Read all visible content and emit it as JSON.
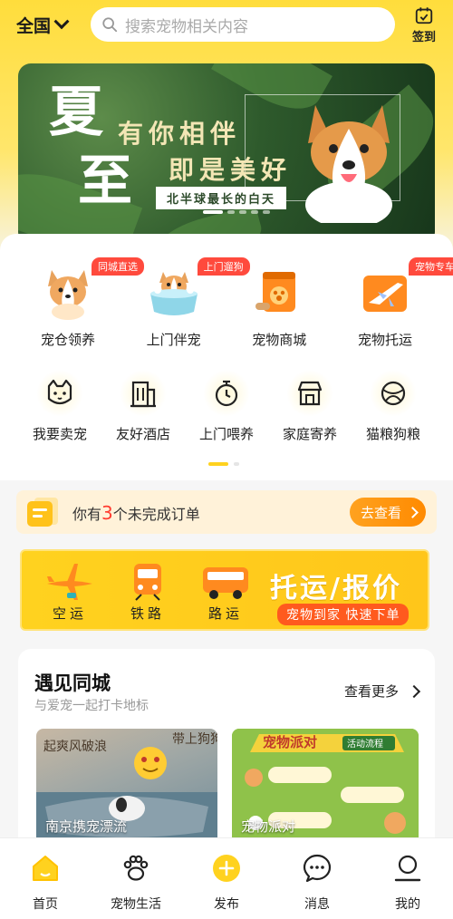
{
  "header": {
    "city": "全国",
    "search_placeholder": "搜索宠物相关内容",
    "checkin_label": "签到"
  },
  "banner": {
    "big_chars": [
      "夏",
      "至"
    ],
    "line1": "有你相伴",
    "line2": "即是美好",
    "tag": "北半球最长的白天",
    "slide_count": 5,
    "active_slide": 1
  },
  "services": {
    "primary": [
      {
        "label": "宠仓领养",
        "badge": "同城直选",
        "icon": "corgi-icon"
      },
      {
        "label": "上门伴宠",
        "badge": "上门遛狗",
        "icon": "dog-bath-icon"
      },
      {
        "label": "宠物商城",
        "badge": "",
        "icon": "pet-food-bag-icon"
      },
      {
        "label": "宠物托运",
        "badge": "宠物专车",
        "icon": "airplane-box-icon"
      }
    ],
    "secondary": [
      {
        "label": "我要卖宠",
        "icon": "cat-face-icon"
      },
      {
        "label": "友好酒店",
        "icon": "building-icon"
      },
      {
        "label": "上门喂养",
        "icon": "stopwatch-icon"
      },
      {
        "label": "家庭寄养",
        "icon": "house-icon"
      },
      {
        "label": "猫粮狗粮",
        "icon": "ball-icon"
      }
    ]
  },
  "orders": {
    "prefix": "你有",
    "count": "3",
    "suffix": "个未完成订单",
    "button": "去查看"
  },
  "transport": {
    "modes": [
      {
        "label": "空运",
        "icon": "airplane-icon"
      },
      {
        "label": "铁路",
        "icon": "train-icon"
      },
      {
        "label": "路运",
        "icon": "bus-icon"
      }
    ],
    "title": "托运/报价",
    "subtitle": "宠物到家 快速下单"
  },
  "nearby": {
    "title": "遇见同城",
    "subtitle": "与爱宠一起打卡地标",
    "more": "查看更多",
    "cards": [
      {
        "caption": "南京携宠漂流"
      },
      {
        "caption": "宠物派对"
      }
    ]
  },
  "tabbar": {
    "items": [
      {
        "label": "首页",
        "icon": "home-icon",
        "active": true
      },
      {
        "label": "宠物生活",
        "icon": "paw-icon",
        "active": false
      },
      {
        "label": "发布",
        "icon": "plus-icon",
        "active": false
      },
      {
        "label": "消息",
        "icon": "message-icon",
        "active": false
      },
      {
        "label": "我的",
        "icon": "profile-icon",
        "active": false
      }
    ]
  },
  "colors": {
    "brand": "#ffd21f",
    "badge": "#ff4a3d",
    "accent": "#ff8a00"
  }
}
